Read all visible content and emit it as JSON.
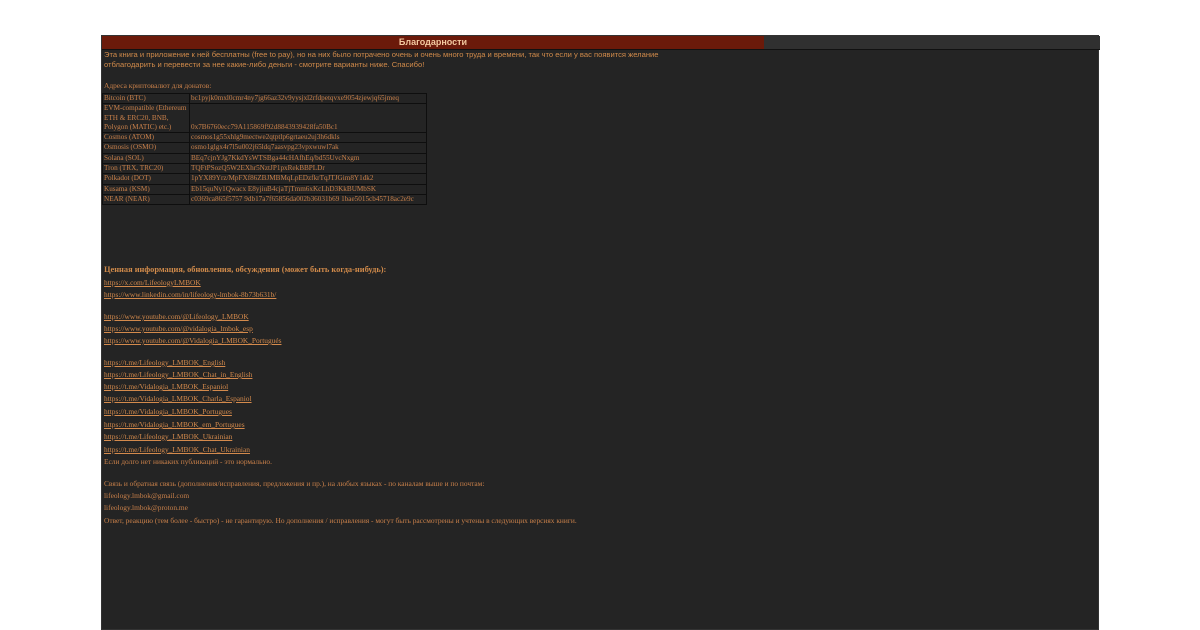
{
  "title": "Благодарности",
  "intro": {
    "line1": "Эта книга и приложение к ней бесплатны (free to pay), но на них было потрачено очень и очень много труда и времени, так что если у вас появится желание",
    "line2": "отблагодарить и перевести за нее какие-либо деньги - смотрите варианты ниже. Спасибо!"
  },
  "addresses_label": "Адреса криптовалют для донатов:",
  "crypto": [
    {
      "name": "Bitcoin (BTC)",
      "address": "bc1pyjk0mxl0cmr4ny7jg66az32v9yysjxl2rfdpetqvxe9054zjewjq65jmeq"
    },
    {
      "name": "EVM-compatible (Ethereum ETH & ERC20, BNB, Polygon (MATIC) etc.)",
      "address": "0x7B6760ecc79A115869f92d8843939428fa50Bc1"
    },
    {
      "name": "Cosmos (ATOM)",
      "address": "cosmos1g55xhlg9mectwe2qtptlp6grtaeu2uj3h6dkls"
    },
    {
      "name": "Osmosis (OSMO)",
      "address": "osmo1glgx4r7l5u002j65ldq7aasvpg23vpxwuwl7ak"
    },
    {
      "name": "Solana (SOL)",
      "address": "BEq7cjnYJg7KkdYsWTSBga44cHAfhEq/bd55UvcNxgm"
    },
    {
      "name": "Tron (TRX, TRC20)",
      "address": "TQFtPSozQ5W2EXhr5NztJP1pxRekBBPLDr"
    },
    {
      "name": "Polkadot (DOT)",
      "address": "1pYX89Yrz/MpFXf86ZBJMBMqLpEDzfkrTqJTJGim8Y1dk2"
    },
    {
      "name": "Kusama (KSM)",
      "address": "Eb15quNy1Qwacx E8yjiuB4cjaTjTmm6xKcLhD3KkBUMbSK"
    },
    {
      "name": "NEAR (NEAR)",
      "address": "c0369ca865f5757 9db17a7f65856da002b36031b69 1bae5015cb45718ac2e9c"
    }
  ],
  "info_heading": "Ценная информация, обновления, обсуждения (может быть когда-нибудь):",
  "links_social": [
    "https://x.com/LifeologyLMBOK",
    "https://www.linkedin.com/in/lifeology-lmbok-8b73b631b/"
  ],
  "links_youtube": [
    "https://www.youtube.com/@Lifeology_LMBOK",
    "https://www.youtube.com/@vidalogia_lmbok_esp",
    "https://www.youtube.com/@Vidalogia_LMBOK_Portugués"
  ],
  "links_telegram": [
    "https://t.me/Lifeology_LMBOK_English",
    "https://t.me/Lifeology_LMBOK_Chat_in_English",
    "https://t.me/Vidalogia_LMBOK_Espaniol",
    "https://t.me/Vidalogia_LMBOK_Charla_Espaniol",
    "https://t.me/Vidalogia_LMBOK_Portugues",
    "https://t.me/Vidalogia_LMBOK_em_Portugues",
    "https://t.me/Lifeology_LMBOK_Ukrainian",
    "https://t.me/Lifeology_LMBOK_Chat_Ukrainian"
  ],
  "no_publications_note": "Если долго нет никаких публикаций - это нормально.",
  "feedback_text": "Связь и обратная связь (дополнения/исправления, предложения и пр.), на любых языках - по каналам выше и по почтам:",
  "emails": [
    "lifeology.lmbok@gmail.com",
    "lifeology.lmbok@proton.me"
  ],
  "reply_note": "Ответ, реакцию (тем более - быстро) - не гарантирую. Но дополнения / исправления - могут быть рассмотрены и учтены в следующих версиях книги."
}
